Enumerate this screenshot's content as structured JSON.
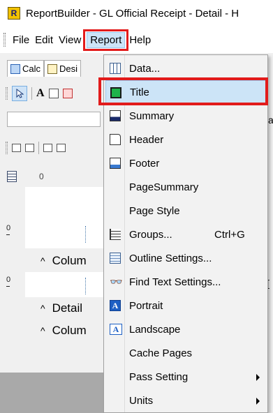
{
  "window": {
    "title": "ReportBuilder - GL Official Receipt - Detail - H",
    "icon": "app-logo-icon",
    "icon_letter": "R"
  },
  "menubar": {
    "items": [
      {
        "label": "File"
      },
      {
        "label": "Edit"
      },
      {
        "label": "View"
      },
      {
        "label": "Report",
        "open": true
      },
      {
        "label": "Help"
      }
    ]
  },
  "tabs": [
    {
      "label": "Calc",
      "icon": "calc-icon"
    },
    {
      "label": "Desi",
      "icon": "design-icon"
    }
  ],
  "design": {
    "ruler_zero": "0",
    "vertical_ticks": [
      "0",
      "0"
    ],
    "bands": [
      {
        "label": "Colum"
      },
      {
        "label": "Detail"
      },
      {
        "label": "Colum"
      }
    ]
  },
  "peek": {
    "right_text": "a",
    "right_bracket": "["
  },
  "report_menu": {
    "items": [
      {
        "label": "Data...",
        "icon": "data-grid-icon"
      },
      {
        "label": "Title",
        "icon": "title-band-icon",
        "highlighted": true
      },
      {
        "label": "Summary",
        "icon": "summary-band-icon"
      },
      {
        "label": "Header",
        "icon": "header-icon"
      },
      {
        "label": "Footer",
        "icon": "footer-icon"
      },
      {
        "label": "PageSummary",
        "icon": ""
      },
      {
        "label": "Page Style",
        "icon": ""
      },
      {
        "label": "Groups...",
        "icon": "groups-icon",
        "shortcut": "Ctrl+G"
      },
      {
        "label": "Outline Settings...",
        "icon": "outline-icon"
      },
      {
        "label": "Find Text Settings...",
        "icon": "binoculars-icon"
      },
      {
        "label": "Portrait",
        "icon": "portrait-icon"
      },
      {
        "label": "Landscape",
        "icon": "landscape-icon"
      },
      {
        "label": "Cache Pages",
        "icon": ""
      },
      {
        "label": "Pass Setting",
        "icon": "",
        "submenu": true
      },
      {
        "label": "Units",
        "icon": "",
        "submenu": true
      }
    ],
    "portrait_glyph": "A",
    "landscape_glyph": "A",
    "find_glyph": "👓"
  },
  "colors": {
    "highlight_border": "#e21b1b",
    "selection_fill": "#cce4f7"
  }
}
